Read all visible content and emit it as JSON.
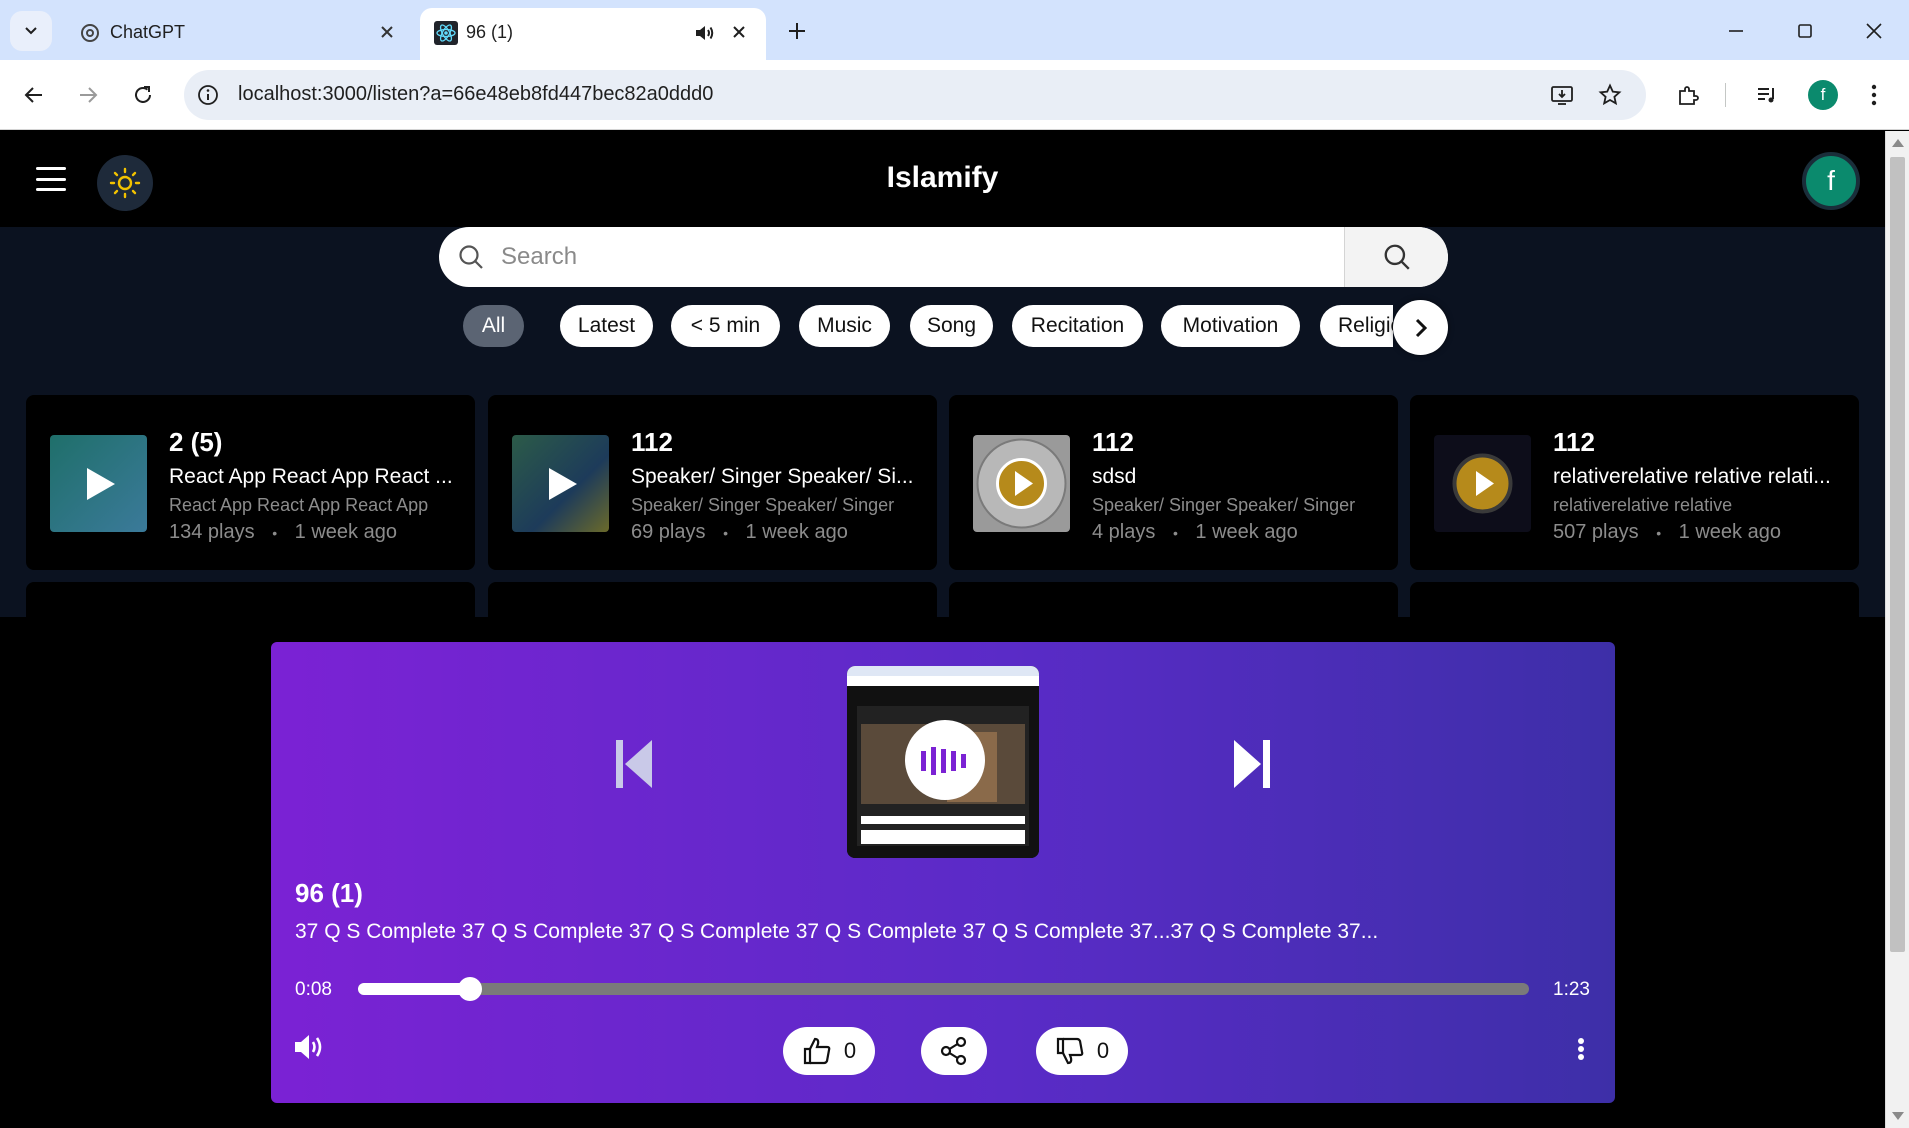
{
  "browser": {
    "tabs": [
      {
        "title": "ChatGPT"
      },
      {
        "title": "96 (1)"
      }
    ],
    "url": "localhost:3000/listen?a=66e48eb8fd447bec82a0ddd0",
    "profile_initial": "f"
  },
  "app": {
    "title": "Islamify",
    "avatar_initial": "f"
  },
  "search": {
    "placeholder": "Search"
  },
  "filters": {
    "chips": [
      "All",
      "Latest",
      "< 5 min",
      "Music",
      "Song",
      "Recitation",
      "Motivation",
      "Religion"
    ],
    "selected": "All"
  },
  "cards": [
    {
      "title": "2 (5)",
      "subtitle": "React App React App React ...",
      "artist": "React App React App React App",
      "plays": "134 plays",
      "age": "1 week ago"
    },
    {
      "title": "112",
      "subtitle": "Speaker/ Singer Speaker/ Si...",
      "artist": "Speaker/ Singer Speaker/ Singer",
      "plays": "69 plays",
      "age": "1 week ago"
    },
    {
      "title": "112",
      "subtitle": "sdsd",
      "artist": "Speaker/ Singer Speaker/ Singer",
      "plays": "4 plays",
      "age": "1 week ago"
    },
    {
      "title": "112",
      "subtitle": "relativerelative relative relati...",
      "artist": "relativerelative relative",
      "plays": "507 plays",
      "age": "1 week ago"
    }
  ],
  "meta_separator": "•",
  "player": {
    "title": "96 (1)",
    "description": "37 Q S Complete 37 Q S Complete 37 Q S Complete 37 Q S Complete 37 Q S Complete 37...37 Q S Complete 37...",
    "current_time": "0:08",
    "duration": "1:23",
    "progress_fraction": 0.096,
    "likes": "0",
    "dislikes": "0"
  },
  "colors": {
    "player_gradient_start": "#7b22d4",
    "player_gradient_end": "#3d2fa8",
    "avatar": "#0b8a6d",
    "theme_icon": "#f2c200",
    "content_bg": "#0b1220"
  }
}
